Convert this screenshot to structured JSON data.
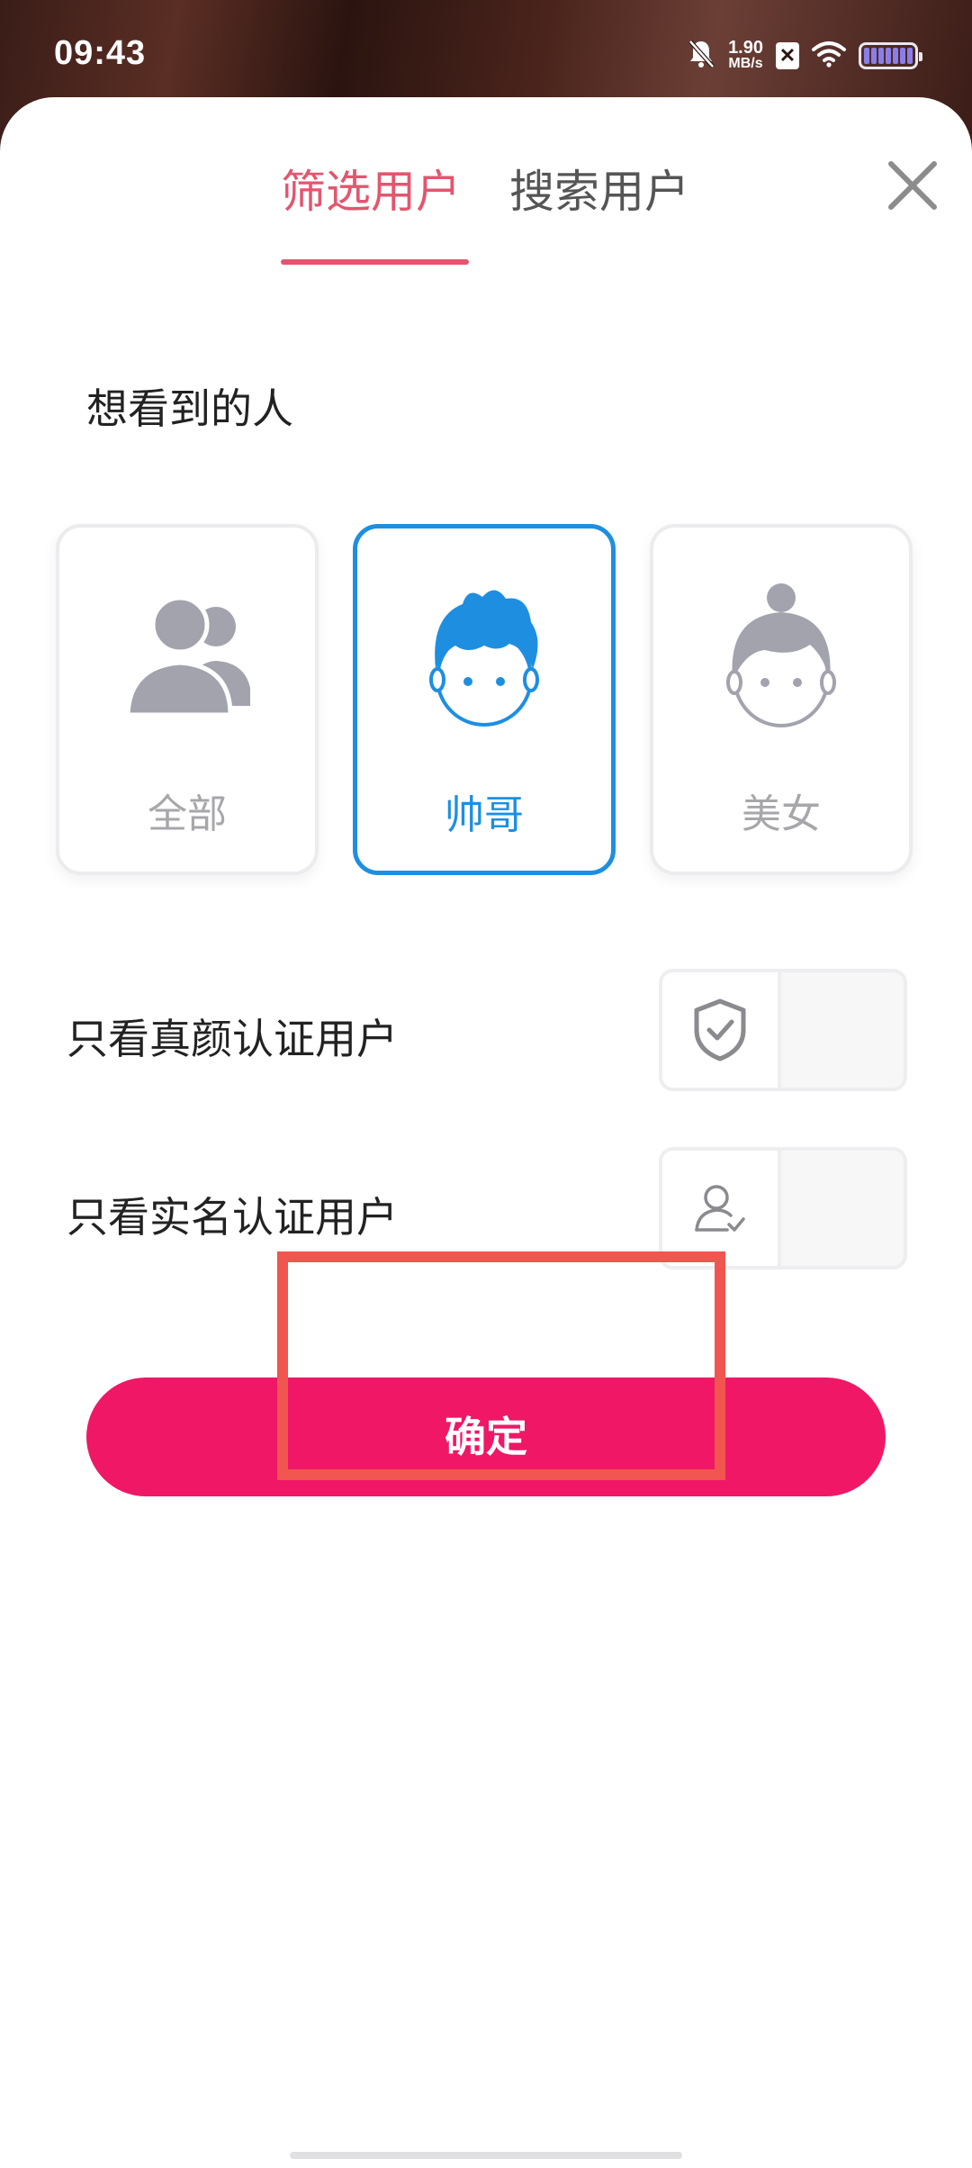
{
  "status_bar": {
    "time": "09:43",
    "net_speed_value": "1.90",
    "net_speed_unit": "MB/s",
    "sim_label": "✕",
    "icons": [
      "bell-muted-icon",
      "network-speed",
      "sim-x-icon",
      "wifi-icon",
      "battery-icon"
    ]
  },
  "tabs": [
    {
      "label": "筛选用户",
      "active": true
    },
    {
      "label": "搜索用户",
      "active": false
    }
  ],
  "close_icon": "close-icon",
  "section_title": "想看到的人",
  "gender_options": [
    {
      "label": "全部",
      "icon": "group-users-icon",
      "selected": false
    },
    {
      "label": "帅哥",
      "icon": "boy-face-icon",
      "selected": true
    },
    {
      "label": "美女",
      "icon": "girl-face-icon",
      "selected": false
    }
  ],
  "filters": [
    {
      "label": "只看真颜认证用户",
      "icon": "shield-check-icon",
      "enabled": false
    },
    {
      "label": "只看实名认证用户",
      "icon": "user-check-icon",
      "enabled": false
    }
  ],
  "confirm_label": "确定",
  "colors": {
    "accent_pink": "#e2566f",
    "button_pink": "#ef1766",
    "selected_blue": "#1e8fe0",
    "muted_gray": "#a6a6ab",
    "highlight_red": "#f0564f"
  }
}
